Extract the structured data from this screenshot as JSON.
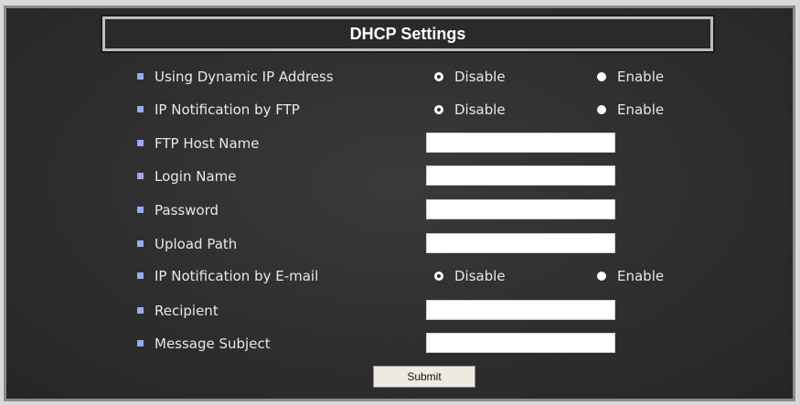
{
  "title": "DHCP Settings",
  "rows": {
    "dynamic_ip": {
      "label": "Using Dynamic IP Address",
      "options": [
        "Disable",
        "Enable"
      ],
      "selected": "Disable"
    },
    "ftp_notify": {
      "label": "IP Notification by FTP",
      "options": [
        "Disable",
        "Enable"
      ],
      "selected": "Disable"
    },
    "ftp_host": {
      "label": "FTP Host Name",
      "value": ""
    },
    "login_name": {
      "label": "Login Name",
      "value": ""
    },
    "password": {
      "label": "Password",
      "value": ""
    },
    "upload_path": {
      "label": "Upload Path",
      "value": ""
    },
    "email_notify": {
      "label": "IP Notification by E-mail",
      "options": [
        "Disable",
        "Enable"
      ],
      "selected": "Disable"
    },
    "recipient": {
      "label": "Recipient",
      "value": ""
    },
    "message_subject": {
      "label": "Message Subject",
      "value": ""
    }
  },
  "submit_label": "Submit",
  "colors": {
    "background": "#2e2e2e",
    "bullet": "#9aa8ff",
    "button": "#efeadf"
  }
}
